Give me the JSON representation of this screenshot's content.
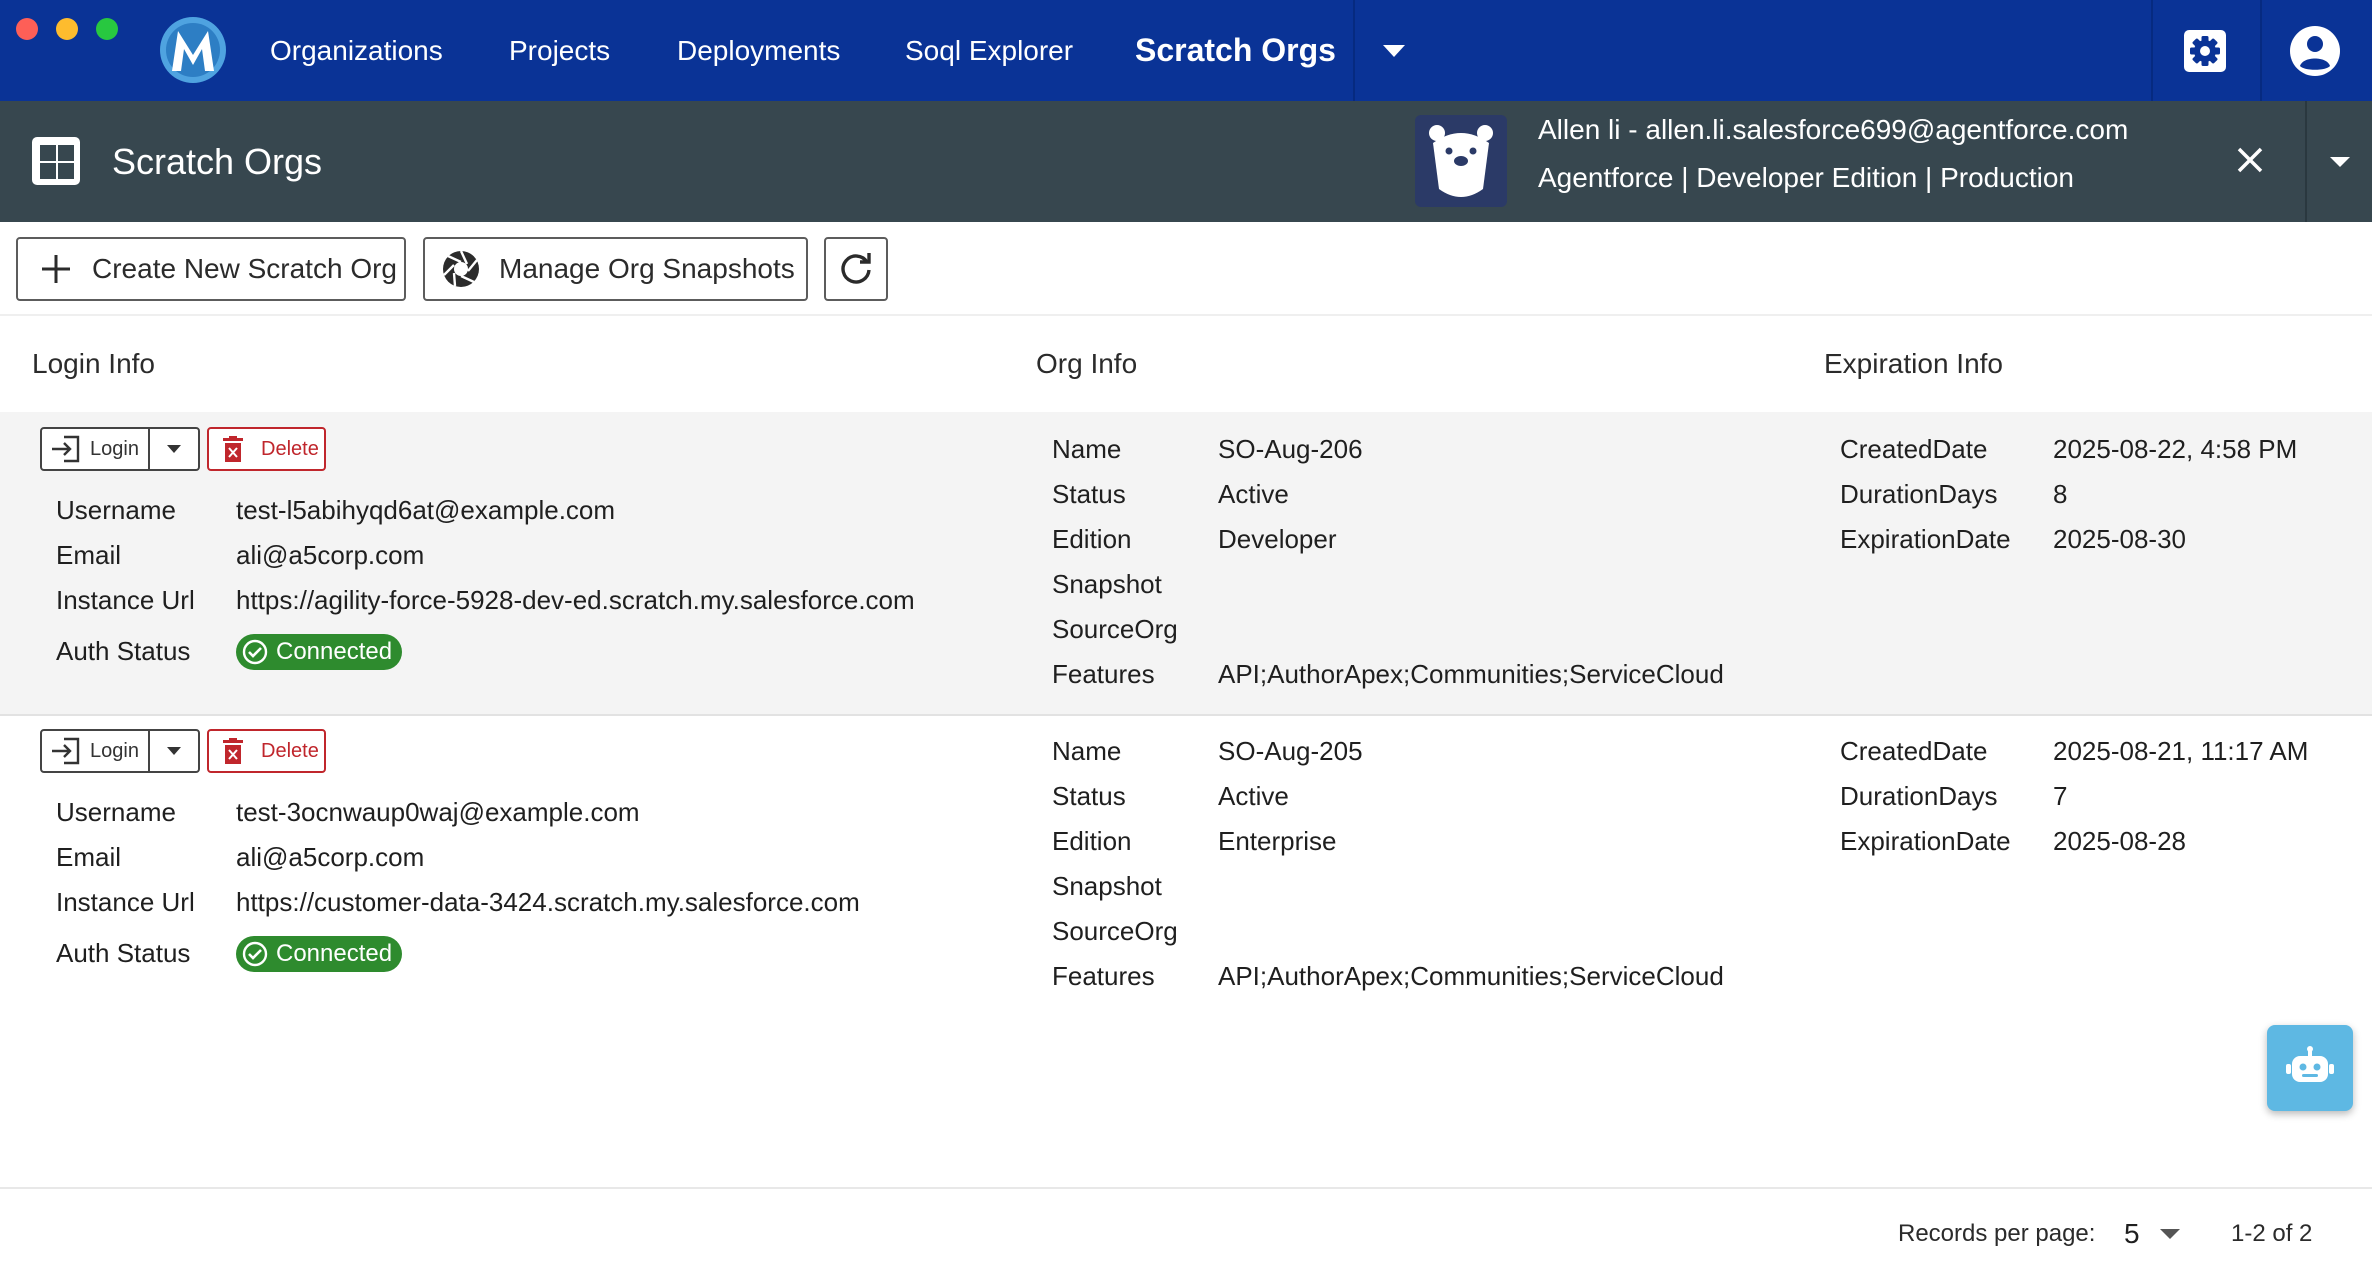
{
  "window": {
    "title": "Scratch Orgs"
  },
  "nav": {
    "items": [
      {
        "label": "Organizations"
      },
      {
        "label": "Projects"
      },
      {
        "label": "Deployments"
      },
      {
        "label": "Soql Explorer"
      },
      {
        "label": "Scratch Orgs",
        "active": true
      }
    ],
    "more_icon": "chevron-down-icon",
    "settings_icon": "gear-icon",
    "account_icon": "account-circle-icon"
  },
  "page": {
    "title": "Scratch Orgs",
    "icon": "apps-grid-icon"
  },
  "org": {
    "line1": "Allen li - allen.li.salesforce699@agentforce.com",
    "line2": "Agentforce | Developer Edition | Production",
    "avatar_icon": "bear-avatar-icon"
  },
  "toolbar": {
    "create_label": "Create New Scratch Org",
    "snapshots_label": "Manage Org Snapshots",
    "refresh_icon": "refresh-icon"
  },
  "columns": {
    "login": "Login Info",
    "org": "Org Info",
    "expiration": "Expiration Info"
  },
  "labels": {
    "login_button": "Login",
    "delete_button": "Delete",
    "username": "Username",
    "email": "Email",
    "instance_url": "Instance Url",
    "auth_status": "Auth Status",
    "name": "Name",
    "status": "Status",
    "edition": "Edition",
    "snapshot": "Snapshot",
    "source_org": "SourceOrg",
    "features": "Features",
    "created_date": "CreatedDate",
    "duration_days": "DurationDays",
    "expiration_date": "ExpirationDate"
  },
  "rows": [
    {
      "username": "test-l5abihyqd6at@example.com",
      "email": "ali@a5corp.com",
      "instance_url": "https://agility-force-5928-dev-ed.scratch.my.salesforce.com",
      "auth_status": "Connected",
      "name": "SO-Aug-206",
      "status": "Active",
      "edition": "Developer",
      "snapshot": "",
      "source_org": "",
      "features": "API;AuthorApex;Communities;ServiceCloud",
      "created_date": "2025-08-22, 4:58 PM",
      "duration_days": "8",
      "expiration_date": "2025-08-30"
    },
    {
      "username": "test-3ocnwaup0waj@example.com",
      "email": "ali@a5corp.com",
      "instance_url": "https://customer-data-3424.scratch.my.salesforce.com",
      "auth_status": "Connected",
      "name": "SO-Aug-205",
      "status": "Active",
      "edition": "Enterprise",
      "snapshot": "",
      "source_org": "",
      "features": "API;AuthorApex;Communities;ServiceCloud",
      "created_date": "2025-08-21, 11:17 AM",
      "duration_days": "7",
      "expiration_date": "2025-08-28"
    }
  ],
  "footer": {
    "records_per_page_label": "Records per page:",
    "records_per_page_value": "5",
    "range": "1-2 of 2"
  },
  "assistant": {
    "icon": "robot-icon"
  },
  "colors": {
    "nav_bg": "#0a3396",
    "header_bg": "#37474f",
    "connected": "#2e8b2e",
    "delete": "#c0262c",
    "assistant": "#5eb8e3"
  }
}
